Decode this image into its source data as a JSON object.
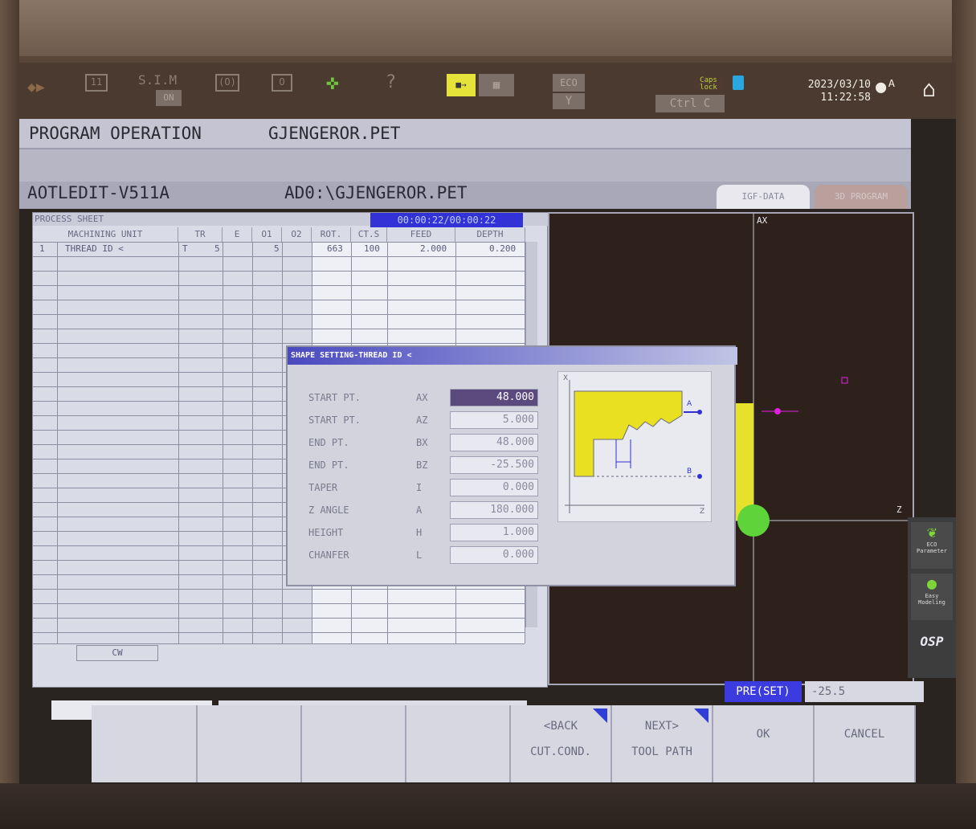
{
  "statusbar": {
    "mode_label": "S.I.M",
    "date": "2023/03/10",
    "time": "11:22:58",
    "caps_lock": "Caps lock",
    "eco_label": "ECO"
  },
  "title": {
    "operation": "PROGRAM OPERATION",
    "program_name": "GJENGEROR.PET"
  },
  "editor": {
    "version": "AOTLEDIT-V511A",
    "path": "AD0:\\GJENGEROR.PET",
    "tabs": [
      "IGF-DATA",
      "3D PROGRAM"
    ]
  },
  "process_sheet": {
    "title": "PROCESS SHEET",
    "timer": "00:00:22/00:00:22",
    "columns": [
      "MACHINING UNIT",
      "TR",
      "E",
      "O1",
      "O2",
      "ROT.",
      "CT.S",
      "FEED",
      "DEPTH"
    ],
    "rows": [
      {
        "no": "1",
        "unit": "THREAD ID <",
        "tr": "T",
        "e": "5",
        "o2": "5",
        "rot": "663",
        "cts": "100",
        "feed": "2.000",
        "depth": "0.200"
      }
    ],
    "footer_label": "CW"
  },
  "dialog": {
    "title": "SHAPE SETTING-THREAD ID <",
    "fields": [
      {
        "label": "START PT.",
        "addr": "AX",
        "value": "48.000"
      },
      {
        "label": "START PT.",
        "addr": "AZ",
        "value": "5.000"
      },
      {
        "label": "END PT.",
        "addr": "BX",
        "value": "48.000"
      },
      {
        "label": "END PT.",
        "addr": "BZ",
        "value": "-25.500"
      },
      {
        "label": "TAPER",
        "addr": "I",
        "value": "0.000"
      },
      {
        "label": "Z ANGLE",
        "addr": "A",
        "value": "180.000"
      },
      {
        "label": "HEIGHT",
        "addr": "H",
        "value": "1.000"
      },
      {
        "label": "CHANFER",
        "addr": "L",
        "value": "0.000"
      }
    ]
  },
  "graphic": {
    "axis_x": "AX",
    "axis_z": "Z"
  },
  "side_icons": {
    "eco_label": "ECO Parameter",
    "easy_label": "Easy Modeling",
    "logo": "OSP"
  },
  "input": {
    "pre_label": "PRE(SET)",
    "pre_value": "-25.5"
  },
  "fkeys": {
    "back_top": "<BACK",
    "back_bottom": "CUT.COND.",
    "next_top": "NEXT>",
    "next_bottom": "TOOL PATH",
    "ok": "OK",
    "cancel": "CANCEL"
  }
}
